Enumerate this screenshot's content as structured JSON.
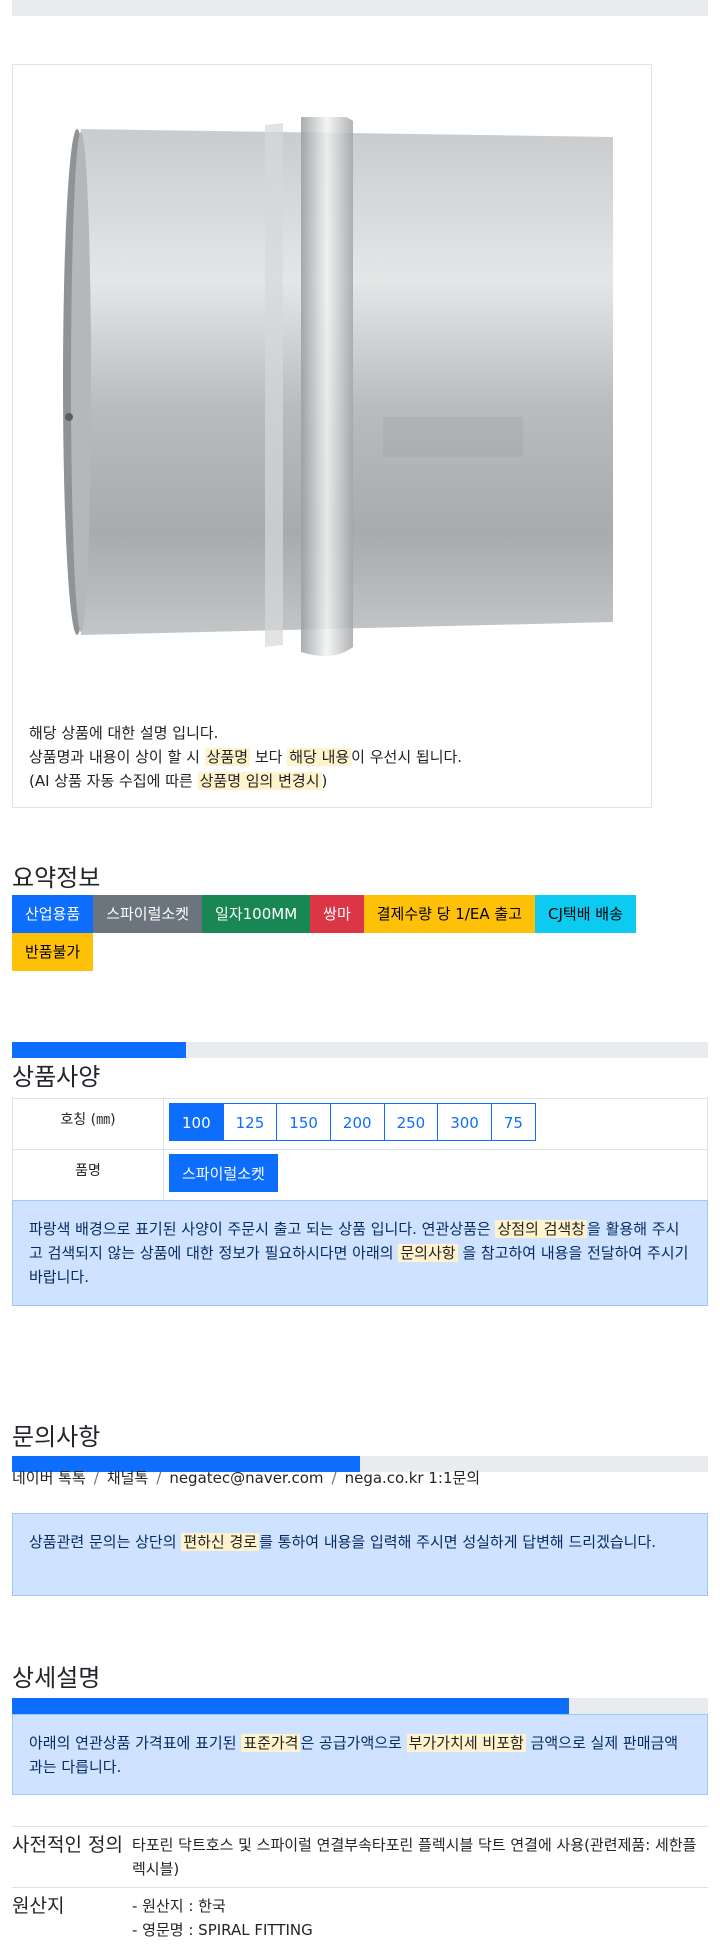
{
  "product_image": {
    "alt": "스파이럴소켓 product photo"
  },
  "description": {
    "line1": "해당 상품에 대한 설명 입니다.",
    "line2_a": "상품명과 내용이 상이 할 시 ",
    "line2_mark1": "상품명",
    "line2_b": " 보다 ",
    "line2_mark2": "해당 내용",
    "line2_c": "이 우선시 됩니다.",
    "line3_a": "(AI 상품 자동 수집에 따른 ",
    "line3_mark": "상품명 임의 변경시",
    "line3_b": ")"
  },
  "summary": {
    "title": "요약정보",
    "badges": [
      "산업용품",
      "스파이럴소켓",
      "일자100MM",
      "쌍마",
      "결제수량 당 1/EA 출고",
      "CJ택배 배송",
      "반품불가"
    ]
  },
  "spec": {
    "title": "상품사양",
    "progress": 0.25,
    "size_label": "호칭 (㎜)",
    "sizes": [
      "100",
      "125",
      "150",
      "200",
      "250",
      "300",
      "75"
    ],
    "selected_size": "100",
    "name_label": "품명",
    "name_value": "스파이럴소켓",
    "notice_a": "파랑색 배경으로 표기된 사양이 주문시 출고 되는 상품 입니다. 연관상품은 ",
    "notice_mark1": "상점의 검색창",
    "notice_b": "을 활용해 주시고 검색되지 않는 상품에 대한 정보가 필요하시다면 아래의 ",
    "notice_mark2": "문의사항",
    "notice_c": " 을 참고하여 내용을 전달하여 주시기 바랍니다."
  },
  "inquiry": {
    "title": "문의사항",
    "progress": 0.5,
    "channels": [
      "네이버 톡톡",
      "채널톡",
      "negatec@naver.com",
      "nega.co.kr 1:1문의"
    ],
    "notice_a": "상품관련 문의는 상단의 ",
    "notice_mark": "편하신 경로",
    "notice_b": "를 통하여 내용을 입력해 주시면 성실하게 답변해 드리겠습니다."
  },
  "detail": {
    "title": "상세설명",
    "progress": 0.8,
    "notice_a": "아래의 연관상품 가격표에 표기된 ",
    "notice_mark1": "표준가격",
    "notice_b": "은 공급가액으로 ",
    "notice_mark2": "부가가치세 비포함",
    "notice_c": " 금액으로 실제 판매금액과는 다릅니다.",
    "rows": [
      {
        "term": "사전적인 정의",
        "value": "타포린 닥트호스 및 스파이럴 연결부속타포린 플렉시블 닥트 연결에 사용(관련제품: 세한플렉시블)"
      },
      {
        "term": "원산지",
        "value1": "- 원산지 : 한국",
        "value2": "- 영문명 : SPIRAL FITTING"
      }
    ]
  },
  "colors": {
    "primary": "#0d6efd",
    "alert_bg": "#cfe2ff",
    "mark_bg": "#fff3cd"
  }
}
